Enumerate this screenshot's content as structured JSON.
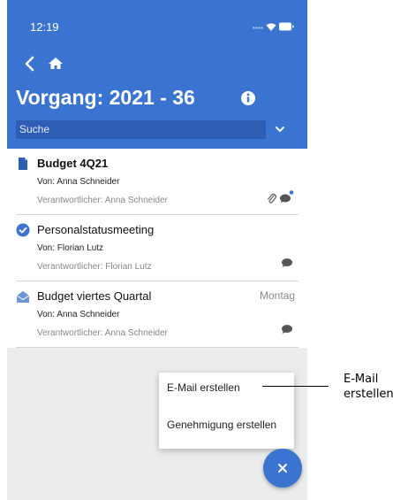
{
  "status_bar": {
    "time": "12:19"
  },
  "header": {
    "title": "Vorgang: 2021 - 36",
    "search_placeholder": "Suche"
  },
  "items": [
    {
      "title": "Budget 4Q21",
      "from": "Von: Anna Schneider",
      "responsible": "Verantwortlicher: Anna Schneider",
      "date": "",
      "icon": "document-icon",
      "has_attachment": true,
      "has_unread_comment": true
    },
    {
      "title": "Personalstatusmeeting",
      "from": "Von: Florian Lutz",
      "responsible": "Verantwortlicher: Florian Lutz",
      "date": "",
      "icon": "check-circle-icon",
      "has_attachment": false,
      "has_unread_comment": false
    },
    {
      "title": "Budget viertes Quartal",
      "from": "Von: Anna Schneider",
      "responsible": "Verantwortlicher: Anna Schneider",
      "date": "Montag",
      "icon": "open-envelope-icon",
      "has_attachment": false,
      "has_unread_comment": false
    }
  ],
  "popup_menu": {
    "create_email": "E-Mail erstellen",
    "create_approval": "Genehmigung erstellen"
  },
  "annotation": {
    "callout_line1": "E-Mail",
    "callout_line2": "erstellen"
  },
  "colors": {
    "accent": "#3a73d0",
    "unread_dot": "#3a73d0",
    "background": "#ececec"
  }
}
